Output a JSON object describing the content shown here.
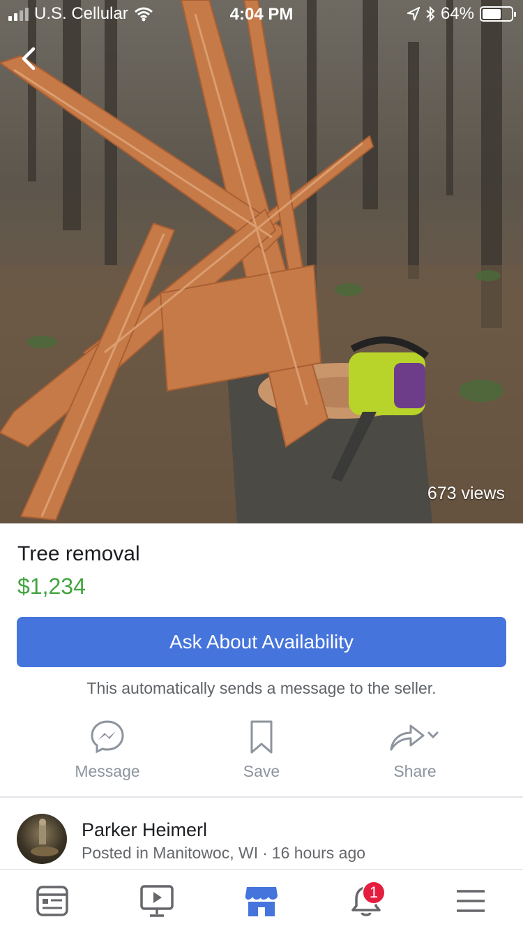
{
  "status_bar": {
    "carrier": "U.S. Cellular",
    "time": "4:04 PM",
    "battery": "64%",
    "battery_level": 0.64
  },
  "photo": {
    "views": "673 views"
  },
  "listing": {
    "title": "Tree removal",
    "price": "$1,234"
  },
  "cta": {
    "label": "Ask About Availability",
    "note": "This automatically sends a message to the seller."
  },
  "actions": [
    {
      "label": "Message",
      "icon": "messenger-icon"
    },
    {
      "label": "Save",
      "icon": "bookmark-icon"
    },
    {
      "label": "Share",
      "icon": "share-icon"
    }
  ],
  "seller": {
    "name": "Parker Heimerl",
    "posted": "Posted in Manitowoc, WI",
    "separator": "·",
    "time_ago": "16 hours ago"
  },
  "tabbar": {
    "items": [
      {
        "icon": "news-feed-icon",
        "active": false
      },
      {
        "icon": "watch-icon",
        "active": false
      },
      {
        "icon": "marketplace-icon",
        "active": true
      },
      {
        "icon": "notifications-icon",
        "active": false,
        "badge": "1"
      },
      {
        "icon": "menu-icon",
        "active": false
      }
    ]
  },
  "colors": {
    "accent": "#4574dc",
    "price": "#42a440",
    "badge": "#e41e3f",
    "muted": "#8d949e"
  }
}
